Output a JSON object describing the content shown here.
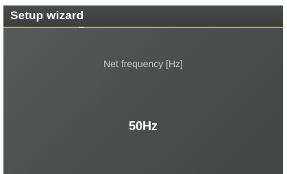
{
  "header": {
    "title": "Setup wizard"
  },
  "setting": {
    "label": "Net frequency [Hz]",
    "value": "50Hz"
  },
  "colors": {
    "accent": "#e0a020",
    "background": "#505151",
    "title_text": "#ffffff",
    "label_text": "#c9c9c9"
  }
}
